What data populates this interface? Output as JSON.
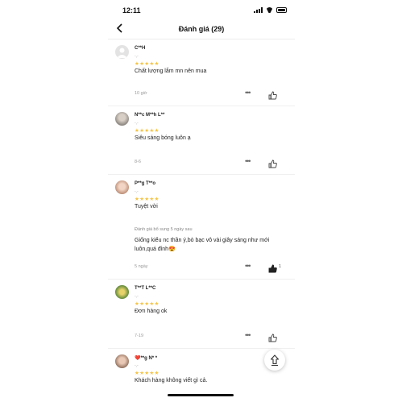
{
  "status_bar": {
    "time": "12:11"
  },
  "header": {
    "title": "Đánh giá (29)"
  },
  "reviews": [
    {
      "user": "C**H",
      "variant": "-,-",
      "stars": "★★★★★",
      "rating": 5,
      "text": "Chất lượng lắm mn nên mua",
      "date": "10 giờ",
      "likes": ""
    },
    {
      "user": "N**c M**h L**",
      "variant": "-,-",
      "stars": "★★★★★",
      "rating": 5,
      "text": "Siêu sáng bóng luôn ạ",
      "date": "8-6",
      "likes": ""
    },
    {
      "user": "P**g T**o",
      "variant": "-,-",
      "stars": "★★★★★",
      "rating": 5,
      "text": "Tuyệt vời",
      "supplement_label": "Đánh giá bổ sung 5 ngày sau",
      "supplement_text": "Giống kiểu nc thần ý,bò bạc vô vài giây sáng như mới luôn,quá đỉnh😍",
      "date": "5 ngày",
      "likes": "1"
    },
    {
      "user": "T**T L**C",
      "variant": "-,-",
      "stars": "★★★★★",
      "rating": 5,
      "text": "Đơn hàng ok",
      "date": "7-19",
      "likes": ""
    },
    {
      "user": "❤️**g N* *",
      "variant": "-,-",
      "stars": "★★★★★",
      "rating": 5,
      "text": "Khách hàng không viết gì cả.",
      "date": "",
      "likes": ""
    }
  ],
  "more_label": "•••",
  "colors": {
    "star": "#f6c343",
    "divider": "#ececec"
  }
}
